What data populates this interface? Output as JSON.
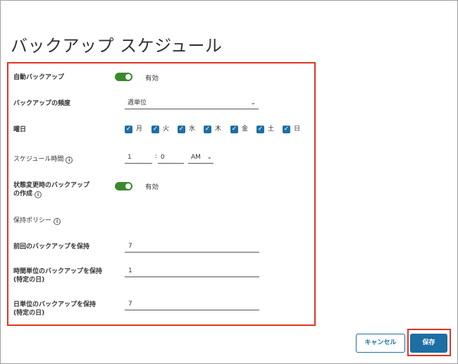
{
  "dialog": {
    "title": "バックアップ スケジュール"
  },
  "form": {
    "auto_backup": {
      "label": "自動バックアップ",
      "state": "有効",
      "enabled": true
    },
    "frequency": {
      "label": "バックアップの頻度",
      "value": "週単位"
    },
    "weekday": {
      "label": "曜日",
      "days": [
        {
          "label": "月",
          "checked": true
        },
        {
          "label": "火",
          "checked": true
        },
        {
          "label": "水",
          "checked": true
        },
        {
          "label": "木",
          "checked": true
        },
        {
          "label": "金",
          "checked": true
        },
        {
          "label": "土",
          "checked": true
        },
        {
          "label": "日",
          "checked": true
        }
      ]
    },
    "schedule_time": {
      "label": "スケジュール時間",
      "hour": "1",
      "separator": ":",
      "minute": "0",
      "ampm": "AM"
    },
    "state_change_backup": {
      "label_line1": "状態変更時のバックアップ",
      "label_line2": "の作成",
      "state": "有効",
      "enabled": true
    },
    "retention_policy": {
      "label": "保持ポリシー"
    },
    "keep_previous": {
      "label": "前回のバックアップを保持",
      "value": "7"
    },
    "keep_hourly": {
      "label_line1": "時間単位のバックアップを保持",
      "label_line2": "(特定の日)",
      "value": "1"
    },
    "keep_daily": {
      "label_line1": "日単位のバックアップを保持",
      "label_line2": "(特定の日)",
      "value": "7"
    }
  },
  "footer": {
    "cancel_label": "キャンセル",
    "save_label": "保存"
  },
  "icons": {
    "info": "info-icon",
    "chevron": "chevron-down-icon",
    "check": "check-icon"
  },
  "colors": {
    "toggle_on": "#3a8a2a",
    "checkbox": "#1e6fa6",
    "primary": "#1c6ea4",
    "highlight": "#e0351f"
  }
}
